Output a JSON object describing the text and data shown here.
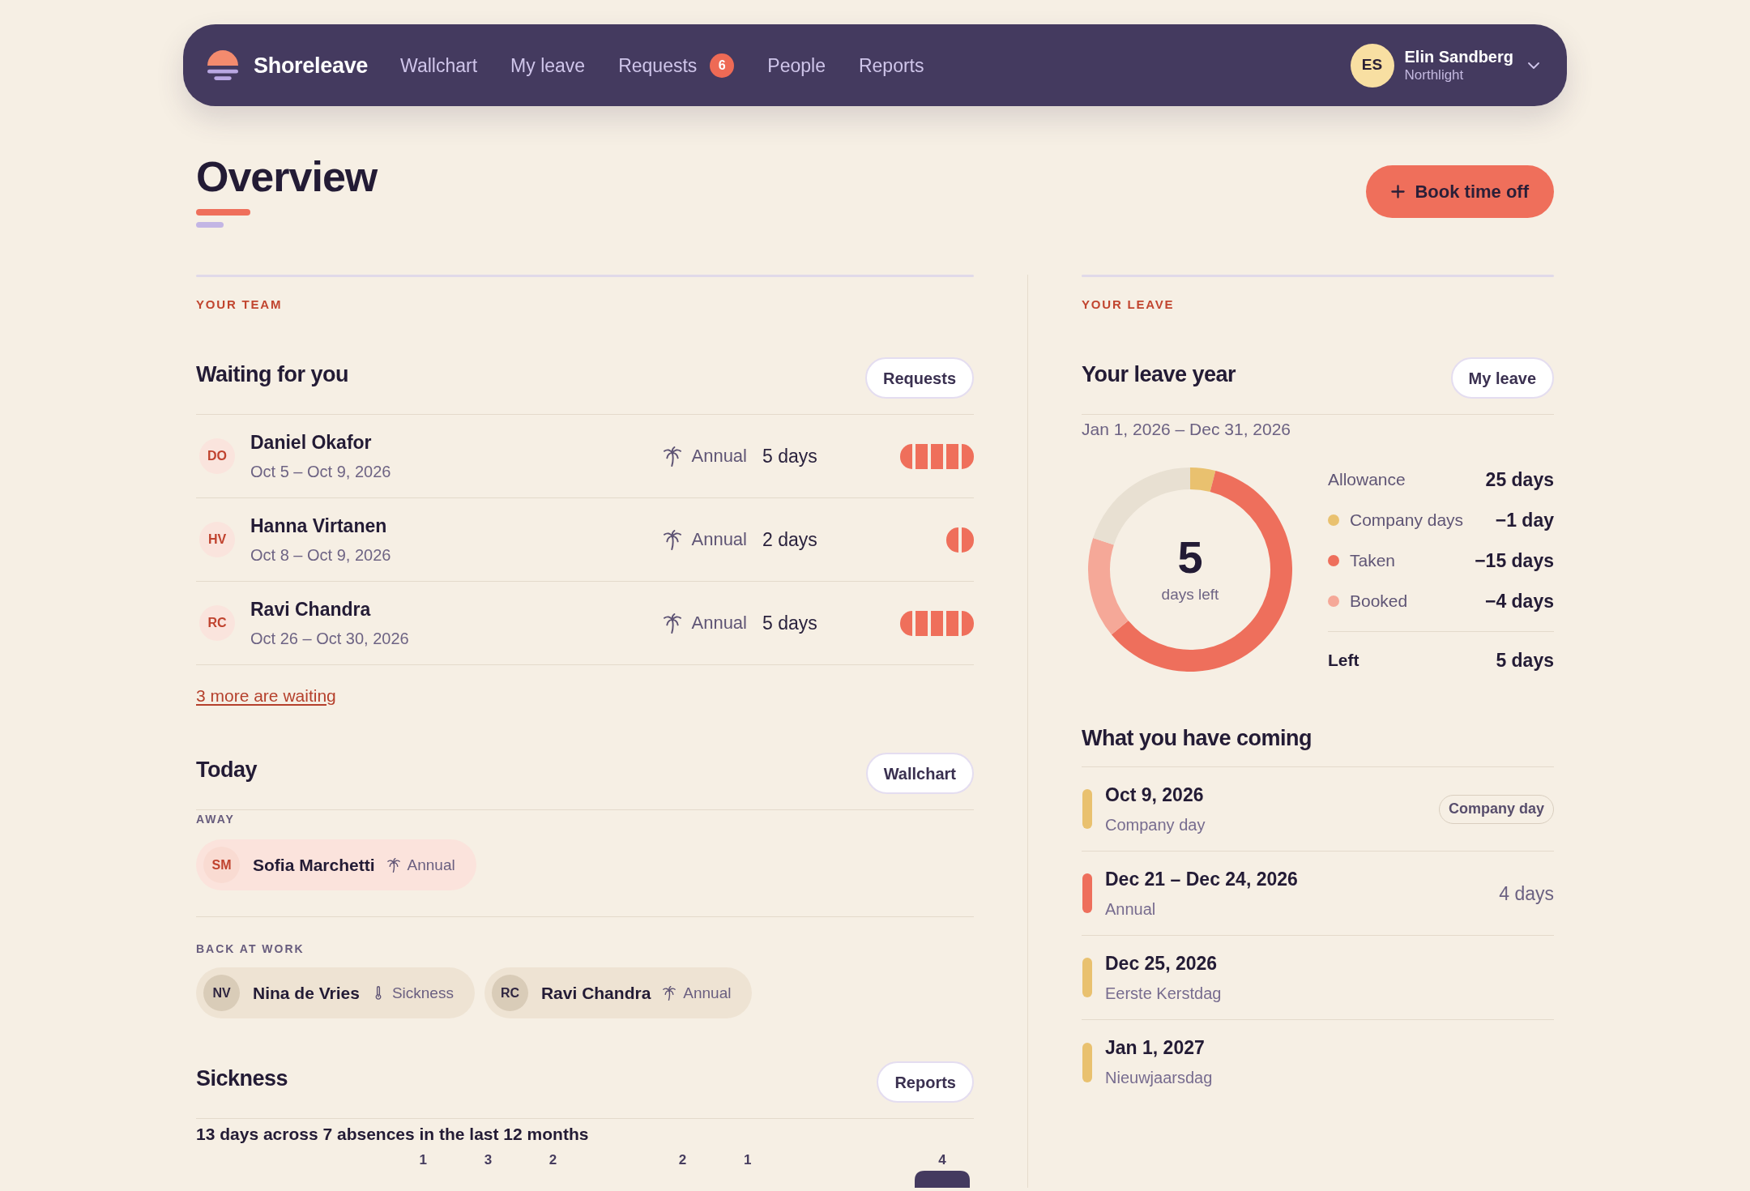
{
  "nav": {
    "brand": "Shoreleave",
    "links": [
      {
        "label": "Wallchart",
        "selected": false
      },
      {
        "label": "My leave",
        "selected": false
      },
      {
        "label": "Requests",
        "selected": false,
        "badge": "6"
      },
      {
        "label": "People",
        "selected": false
      },
      {
        "label": "Reports",
        "selected": false
      }
    ],
    "user": {
      "initials": "ES",
      "name": "Elin Sandberg",
      "organization": "Northlight"
    }
  },
  "header": {
    "title": "Overview",
    "action": "Book time off"
  },
  "team": {
    "eyebrow": "YOUR TEAM",
    "waiting": {
      "title": "Waiting for you",
      "button": "Requests",
      "rows": [
        {
          "initials": "DO",
          "name": "Daniel Okafor",
          "dates": "Oct 5 – Oct 9, 2026",
          "kind": "annual",
          "type": "Annual",
          "days": "5 days"
        },
        {
          "initials": "HV",
          "name": "Hanna Virtanen",
          "dates": "Oct 8 – Oct 9, 2026",
          "kind": "annual",
          "type": "Annual",
          "days": "2 days"
        },
        {
          "initials": "RC",
          "name": "Ravi Chandra",
          "dates": "Oct 26 – Oct 30, 2026",
          "kind": "annual",
          "type": "Annual",
          "days": "5 days"
        }
      ],
      "more_link": "3 more are waiting"
    },
    "today": {
      "title": "Today",
      "button": "Wallchart",
      "groups": [
        {
          "label": "AWAY",
          "kind": "away",
          "people": [
            {
              "initials": "SM",
              "name": "Sofia Marchetti",
              "kind": "annual",
              "type": "Annual"
            }
          ]
        },
        {
          "label": "BACK AT WORK",
          "kind": "back",
          "people": [
            {
              "initials": "NV",
              "name": "Nina de Vries",
              "kind": "sickness",
              "type": "Sickness"
            },
            {
              "initials": "RC",
              "name": "Ravi Chandra",
              "kind": "annual",
              "type": "Annual"
            }
          ]
        }
      ]
    },
    "sickness": {
      "title": "Sickness",
      "button": "Reports",
      "summary": "13 days across 7 absences in the last 12 months",
      "columns": [
        {
          "kind": "gap"
        },
        {
          "kind": "gap"
        },
        {
          "kind": "gap"
        },
        {
          "kind": "bar",
          "count": "1"
        },
        {
          "kind": "bar",
          "count": "3"
        },
        {
          "kind": "bar",
          "count": "2"
        },
        {
          "kind": "gap"
        },
        {
          "kind": "bar",
          "count": "2"
        },
        {
          "kind": "bar",
          "count": "1"
        },
        {
          "kind": "gap"
        },
        {
          "kind": "gap"
        },
        {
          "kind": "bar",
          "count": "4"
        }
      ]
    }
  },
  "leave": {
    "eyebrow": "YOUR LEAVE",
    "year": {
      "title": "Your leave year",
      "button": "My leave",
      "period": "Jan 1, 2026 – Dec 31, 2026",
      "days_left": "5",
      "days_left_caption": "days left",
      "chart_data": {
        "type": "donut",
        "values": [
          4,
          60,
          16,
          20
        ]
      },
      "breakdown": [
        {
          "kind": "total",
          "label": "Allowance",
          "value": "25 days"
        },
        {
          "kind": "legend",
          "label": "Company days",
          "value": "−1 day",
          "color": "#e9c16f"
        },
        {
          "kind": "legend",
          "label": "Taken",
          "value": "−15 days",
          "color": "#ee6f5c"
        },
        {
          "kind": "legend",
          "label": "Booked",
          "value": "−4 days",
          "color": "#f5a898"
        },
        {
          "kind": "result",
          "label": "Left",
          "value": "5 days"
        }
      ]
    },
    "coming": {
      "title": "What you have coming",
      "items": [
        {
          "title": "Oct 9, 2026",
          "subtitle": "Company day",
          "color": "#e9c16f",
          "badge": "Company day"
        },
        {
          "title": "Dec 21 – Dec 24, 2026",
          "subtitle": "Annual",
          "color": "#ee6f5c",
          "duration": "4 days"
        },
        {
          "title": "Dec 25, 2026",
          "subtitle": "Eerste Kerstdag",
          "color": "#e9c16f"
        },
        {
          "title": "Jan 1, 2027",
          "subtitle": "Nieuwjaarsdag",
          "color": "#e9c16f"
        }
      ]
    }
  }
}
